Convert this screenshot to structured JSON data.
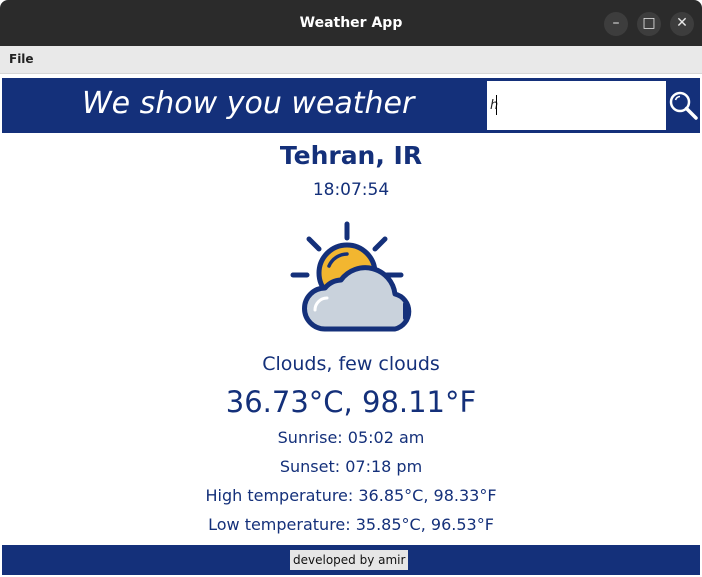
{
  "window": {
    "title": "Weather App",
    "minimize_icon": "minimize-icon",
    "maximize_icon": "maximize-icon",
    "close_icon": "close-icon"
  },
  "menu": {
    "file": "File"
  },
  "header": {
    "headline": "We show you weather",
    "search_value": "h",
    "search_icon": "magnifier-icon"
  },
  "weather": {
    "city": "Tehran, IR",
    "time": "18:07:54",
    "icon": "sun-behind-cloud-icon",
    "description": "Clouds, few clouds",
    "temperature": "36.73°C, 98.11°F",
    "sunrise": "Sunrise: 05:02 am",
    "sunset": "Sunset: 07:18 pm",
    "high": "High temperature: 36.85°C, 98.33°F",
    "low": "Low temperature: 35.85°C, 96.53°F"
  },
  "footer": {
    "credit": "developed by amir"
  },
  "colors": {
    "brand_blue": "#14307a",
    "sun_yellow": "#f2b630",
    "cloud_gray": "#c9d2dc"
  }
}
